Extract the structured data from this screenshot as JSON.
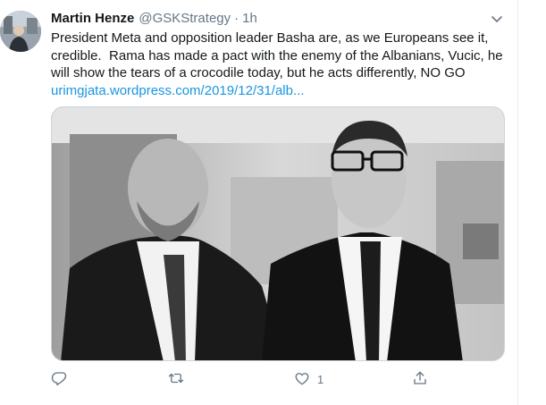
{
  "tweet": {
    "author_name": "Martin Henze",
    "handle": "@GSKStrategy",
    "separator": "·",
    "timestamp": "1h",
    "lines": [
      "President Meta and opposition leader Basha are, as we Europeans see it,",
      "credible.  Rama has made a pact with the enemy of the Albanians, Vucic, he",
      "will show the tears of a crocodile today, but he acts differently, NO GO"
    ],
    "link_text": "urimgjata.wordpress.com/2019/12/31/alb...",
    "actions": {
      "reply_count": "",
      "retweet_count": "",
      "like_count": "1",
      "share_count": ""
    }
  },
  "icons": {
    "caret": "chevron-down-icon",
    "reply": "reply-icon",
    "retweet": "retweet-icon",
    "like": "heart-icon",
    "share": "share-icon"
  },
  "colors": {
    "text": "#14171a",
    "secondary": "#657786",
    "link": "#1b95e0",
    "border": "#e6ecf0"
  }
}
